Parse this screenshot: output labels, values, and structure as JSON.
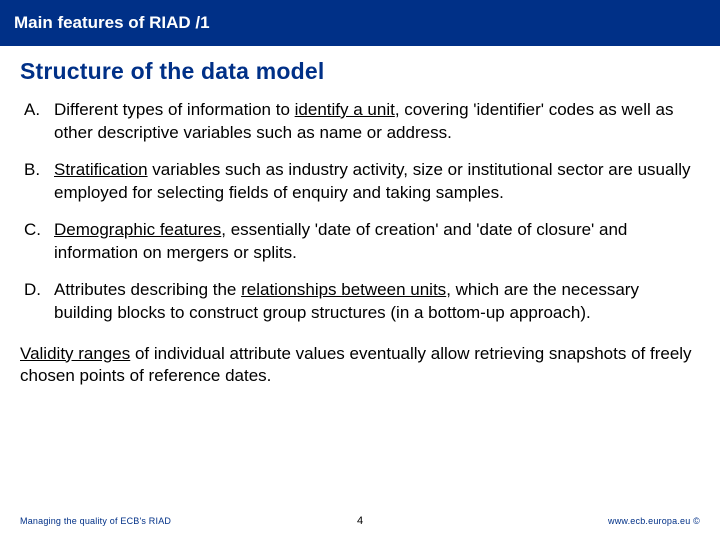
{
  "titlebar": "Main features of RIAD /1",
  "heading": "Structure of the data model",
  "items": [
    {
      "marker": "A.",
      "html": "Different types of information to <u>identify a unit</u>, covering 'identifier' codes as well as other descriptive variables such as name or address."
    },
    {
      "marker": "B.",
      "html": "<u>Stratification</u> variables such as industry activity, size or institutional sector are usually employed for selecting fields of enquiry and taking samples."
    },
    {
      "marker": "C.",
      "html": "<u>Demographic features</u>, essentially 'date of creation' and 'date of closure' and information on mergers or splits."
    },
    {
      "marker": "D.",
      "html": "Attributes describing the <u>relationships between units</u>, which are the necessary building blocks to construct group structures (in a bottom-up approach)."
    }
  ],
  "paragraph": "<u>Validity ranges</u> of individual attribute values eventually allow retrieving snapshots of freely chosen points of reference dates.",
  "footer": {
    "left": "Managing the quality of ECB's RIAD",
    "page": "4",
    "right": "www.ecb.europa.eu",
    "copyright": "©"
  }
}
